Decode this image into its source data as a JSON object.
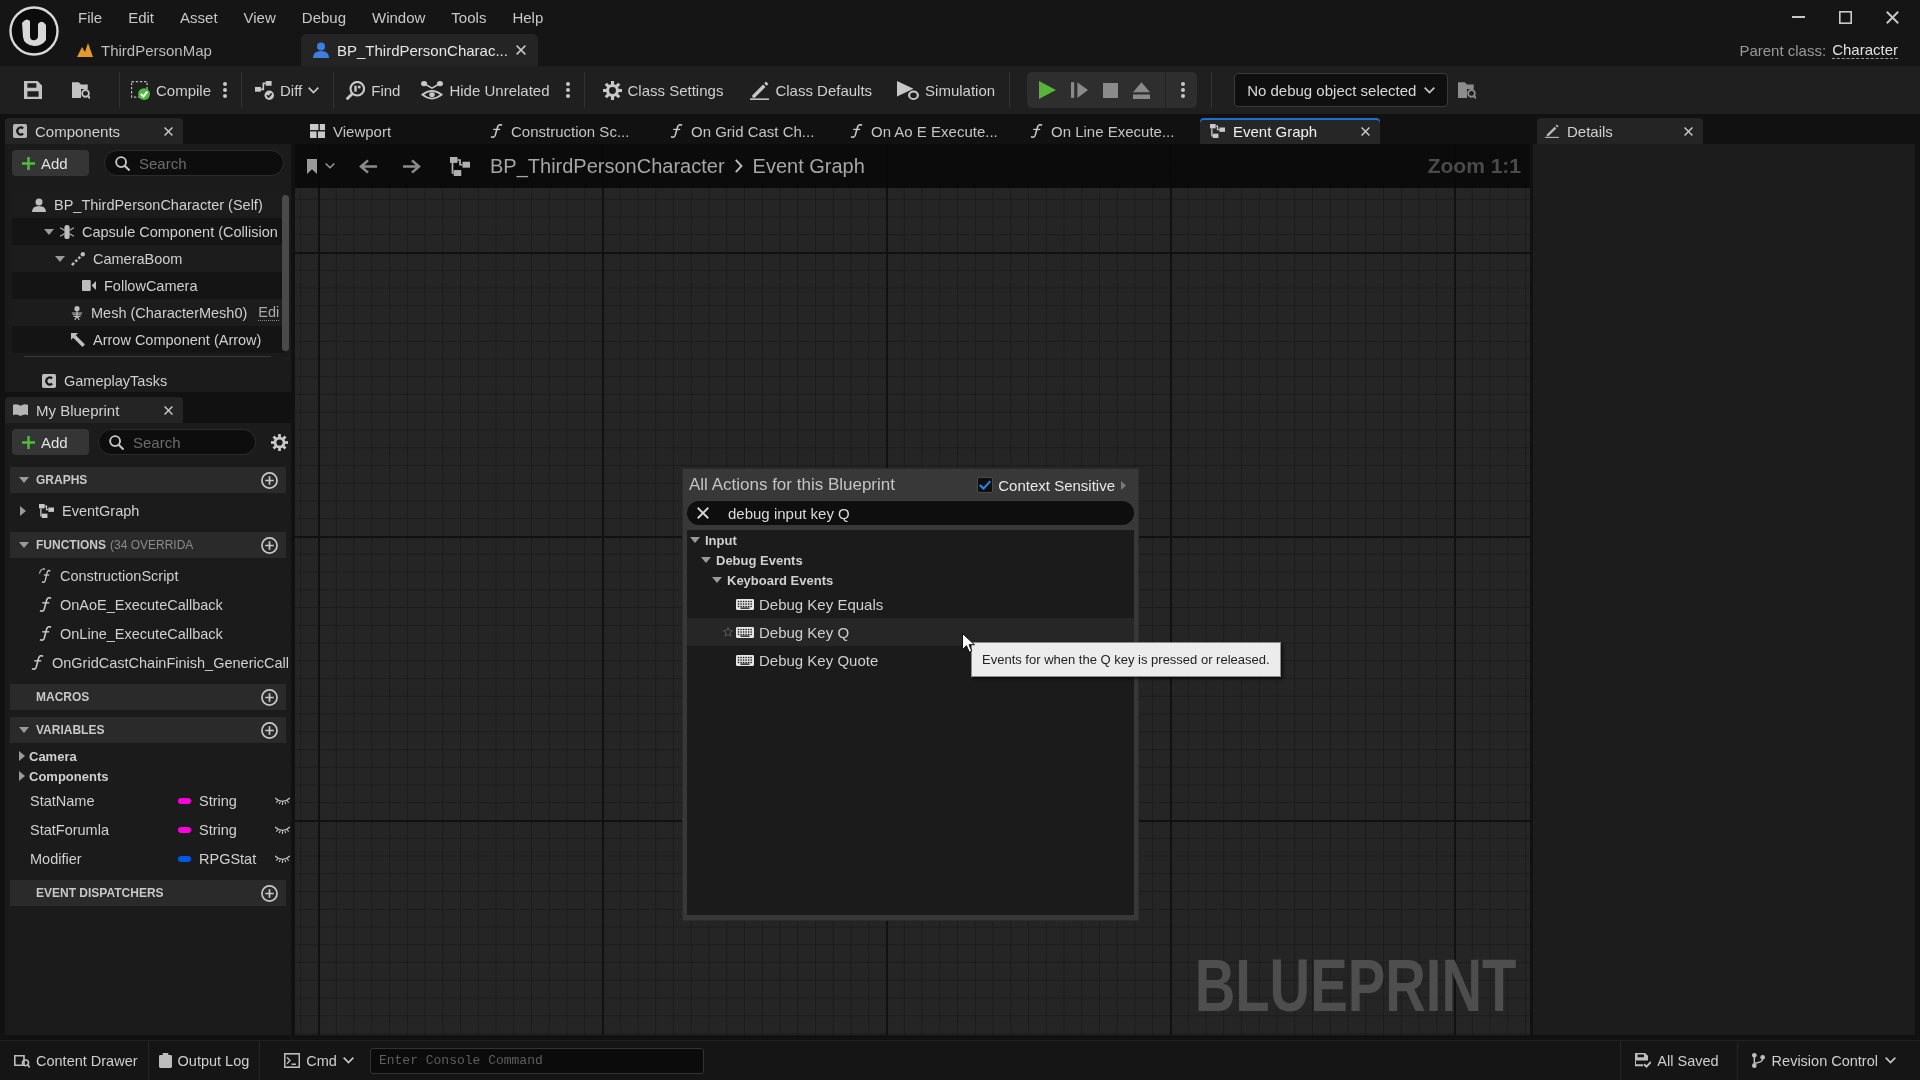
{
  "menu_bar": [
    "File",
    "Edit",
    "Asset",
    "View",
    "Debug",
    "Window",
    "Tools",
    "Help"
  ],
  "document_tabs": [
    {
      "label": "ThirdPersonMap",
      "kind": "level",
      "selected": false
    },
    {
      "label": "BP_ThirdPersonCharac...",
      "kind": "blueprint",
      "selected": true
    }
  ],
  "parent_class": {
    "label": "Parent class:",
    "value": "Character"
  },
  "toolbar": {
    "compile": "Compile",
    "diff": "Diff",
    "find": "Find",
    "hide_unrelated": "Hide Unrelated",
    "class_settings": "Class Settings",
    "class_defaults": "Class Defaults",
    "simulation": "Simulation",
    "debug_object": "No debug object selected"
  },
  "components_panel": {
    "tab": "Components",
    "add_button": "Add",
    "search": {
      "placeholder": "Search"
    },
    "tree": [
      {
        "label": "BP_ThirdPersonCharacter (Self)",
        "kind": "self",
        "children": [
          {
            "label": "Capsule Component (Collision",
            "kind": "capsule",
            "expanded": true,
            "children": [
              {
                "label": "CameraBoom",
                "kind": "spring_arm",
                "expanded": true,
                "children": [
                  {
                    "label": "FollowCamera",
                    "kind": "camera"
                  }
                ]
              },
              {
                "label": "Mesh (CharacterMesh0)",
                "kind": "mesh",
                "link": "Edi"
              },
              {
                "label": "Arrow Component (Arrow)",
                "kind": "arrow"
              }
            ]
          }
        ]
      }
    ],
    "other_components": [
      {
        "label": "GameplayTasks",
        "kind": "component"
      }
    ]
  },
  "my_blueprint_panel": {
    "tab": "My Blueprint",
    "add_button": "Add",
    "search": {
      "placeholder": "Search"
    },
    "sections": [
      {
        "title": "GRAPHS",
        "expanded": true,
        "items": [
          {
            "kind": "graph",
            "label": "EventGraph",
            "expanded": false
          }
        ]
      },
      {
        "title": "FUNCTIONS",
        "note": "(34 OVERRIDA",
        "expanded": true,
        "items": [
          {
            "kind": "construction",
            "label": "ConstructionScript"
          },
          {
            "kind": "function",
            "label": "OnAoE_ExecuteCallback"
          },
          {
            "kind": "function",
            "label": "OnLine_ExecuteCallback"
          },
          {
            "kind": "function",
            "label": "OnGridCastChainFinish_GenericCall"
          }
        ]
      },
      {
        "title": "MACROS"
      },
      {
        "title": "VARIABLES",
        "expanded": true,
        "items": [
          {
            "kind": "category",
            "label": "Camera",
            "expanded": false
          },
          {
            "kind": "category",
            "label": "Components",
            "expanded": false
          },
          {
            "kind": "variable",
            "label": "StatName",
            "type": "String",
            "color": "#ff00dc"
          },
          {
            "kind": "variable",
            "label": "StatForumla",
            "type": "String",
            "color": "#ff00dc"
          },
          {
            "kind": "variable",
            "label": "Modifier",
            "type": "RPGStat",
            "color": "#0058e6"
          }
        ]
      },
      {
        "title": "EVENT DISPATCHERS"
      }
    ]
  },
  "graph_tabs": [
    {
      "label": "Viewport",
      "kind": "viewport",
      "selected": false
    },
    {
      "label": "Construction Sc...",
      "kind": "function",
      "selected": false
    },
    {
      "label": "On Grid Cast Ch...",
      "kind": "function",
      "selected": false
    },
    {
      "label": "On Ao E Execute...",
      "kind": "function",
      "selected": false
    },
    {
      "label": "On Line Execute...",
      "kind": "function",
      "selected": false
    },
    {
      "label": "Event Graph",
      "kind": "graph",
      "selected": true
    }
  ],
  "graph": {
    "breadcrumb": [
      "BP_ThirdPersonCharacter",
      "Event Graph"
    ],
    "zoom": "Zoom 1:1",
    "watermark": "BLUEPRINT"
  },
  "action_menu": {
    "title": "All Actions for this Blueprint",
    "context_sensitive": {
      "label": "Context Sensitive",
      "checked": true
    },
    "search": {
      "value": "debug input key Q"
    },
    "tree": [
      {
        "label": "Input",
        "expanded": true,
        "children": [
          {
            "label": "Debug Events",
            "expanded": true,
            "children": [
              {
                "label": "Keyboard Events",
                "expanded": true,
                "children": [
                  {
                    "label": "Debug Key Equals",
                    "selected": false
                  },
                  {
                    "label": "Debug Key Q",
                    "selected": true
                  },
                  {
                    "label": "Debug Key Quote",
                    "selected": false
                  }
                ]
              }
            ]
          }
        ]
      }
    ],
    "tooltip": "Events for when the Q key is pressed or released."
  },
  "details_panel": {
    "tab": "Details"
  },
  "status_bar": {
    "content_drawer": "Content Drawer",
    "output_log": "Output Log",
    "cmd": "Cmd",
    "console": {
      "placeholder": "Enter Console Command"
    },
    "save_status": "All Saved",
    "revision_control": "Revision Control"
  }
}
